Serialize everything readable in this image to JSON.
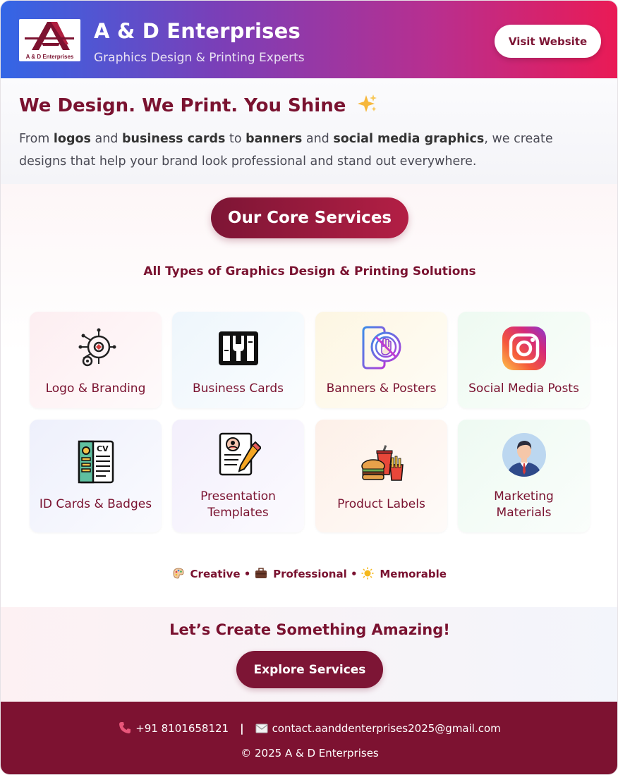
{
  "header": {
    "logo_text": "A & D Enterprises",
    "brand_title": "A & D Enterprises",
    "brand_subtitle": "Graphics Design & Printing Experts",
    "visit_button": "Visit Website"
  },
  "intro": {
    "title": "We Design. We Print. You Shine",
    "title_emoji": "sparkles-icon",
    "text_parts": {
      "p1": "From ",
      "b1": "logos",
      "p2": " and ",
      "b2": "business cards",
      "p3": " to ",
      "b3": "banners",
      "p4": " and ",
      "b4": "social media graphics",
      "p5": ", we create designs that help your brand look professional and stand out everywhere."
    }
  },
  "services": {
    "section_button": "Our Core Services",
    "subtitle": "All Types of Graphics Design & Printing Solutions",
    "items": [
      {
        "label": "Logo & Branding",
        "icon": "brain-gear-icon",
        "bg": "#fdeef1"
      },
      {
        "label": "Business Cards",
        "icon": "tools-card-icon",
        "bg": "#eef6fc"
      },
      {
        "label": "Banners & Posters",
        "icon": "phone-hand-icon",
        "bg": "#fdf6e2"
      },
      {
        "label": "Social Media Posts",
        "icon": "instagram-icon",
        "bg": "#eefaf1"
      },
      {
        "label": "ID Cards & Badges",
        "icon": "cv-icon",
        "bg": "#eef0fc"
      },
      {
        "label_line1": "Presentation",
        "label_line2": "Templates",
        "icon": "document-pencil-icon",
        "bg": "#f3effc"
      },
      {
        "label": "Product Labels",
        "icon": "fast-food-icon",
        "bg": "#fdf0e8"
      },
      {
        "label_line1": "Marketing",
        "label_line2": "Materials",
        "icon": "businessman-avatar-icon",
        "bg": "#eefaf2"
      }
    ],
    "tagline": {
      "t1": "Creative",
      "t2": "Professional",
      "t3": "Memorable",
      "dot": "•"
    }
  },
  "cta": {
    "title": "Let’s Create Something Amazing!",
    "button": "Explore Services"
  },
  "footer": {
    "phone": "+91 8101658121",
    "separator": "|",
    "email": "contact.aanddenterprises2025@gmail.com",
    "copyright": "© 2025 A & D Enterprises"
  }
}
